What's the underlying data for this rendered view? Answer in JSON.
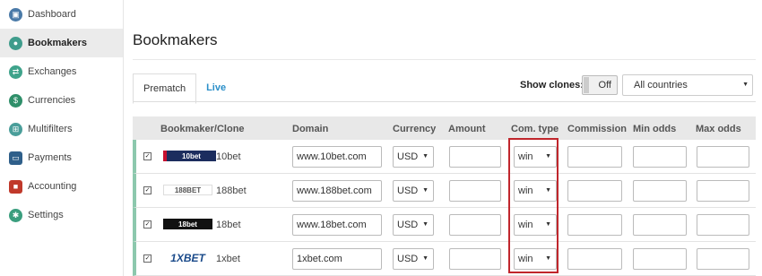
{
  "sidebar": {
    "items": [
      {
        "label": "Dashboard",
        "icon": "dashboard-icon",
        "color": "#4a7aa8"
      },
      {
        "label": "Bookmakers",
        "icon": "bookmakers-icon",
        "color": "#3f9c8c",
        "active": true
      },
      {
        "label": "Exchanges",
        "icon": "exchanges-icon",
        "color": "#3fa38b"
      },
      {
        "label": "Currencies",
        "icon": "currencies-icon",
        "color": "#2f8f6a"
      },
      {
        "label": "Multifilters",
        "icon": "multifilters-icon",
        "color": "#4a9e9a"
      },
      {
        "label": "Payments",
        "icon": "payments-icon",
        "color": "#2f5f8a"
      },
      {
        "label": "Accounting",
        "icon": "accounting-icon",
        "color": "#c0392b"
      },
      {
        "label": "Settings",
        "icon": "settings-icon",
        "color": "#3a9e7e"
      }
    ]
  },
  "page": {
    "title": "Bookmakers"
  },
  "tabs": [
    {
      "label": "Prematch",
      "active": true
    },
    {
      "label": "Live",
      "active": false
    }
  ],
  "clones": {
    "label": "Show clones:",
    "toggle": "Off"
  },
  "country_select": {
    "value": "All countries"
  },
  "table": {
    "headers": [
      "Bookmaker/Clone",
      "Domain",
      "Currency",
      "Amount",
      "Com. type",
      "Commission",
      "Min odds",
      "Max odds"
    ],
    "rows": [
      {
        "checked": true,
        "logo": "10bet",
        "name": "10bet",
        "domain": "www.10bet.com",
        "currency": "USD",
        "amount": "",
        "com_type": "win",
        "commission": "",
        "min_odds": "",
        "max_odds": ""
      },
      {
        "checked": true,
        "logo": "188BET",
        "name": "188bet",
        "domain": "www.188bet.com",
        "currency": "USD",
        "amount": "",
        "com_type": "win",
        "commission": "",
        "min_odds": "",
        "max_odds": ""
      },
      {
        "checked": true,
        "logo": "18bet",
        "name": "18bet",
        "domain": "www.18bet.com",
        "currency": "USD",
        "amount": "",
        "com_type": "win",
        "commission": "",
        "min_odds": "",
        "max_odds": ""
      },
      {
        "checked": true,
        "logo": "1XBET",
        "name": "1xbet",
        "domain": "1xbet.com",
        "currency": "USD",
        "amount": "",
        "com_type": "win",
        "commission": "",
        "min_odds": "",
        "max_odds": ""
      }
    ]
  },
  "colors": {
    "accent": "#2a8fc9",
    "row_border": "#8cc8ad",
    "highlight": "#c0262c"
  }
}
